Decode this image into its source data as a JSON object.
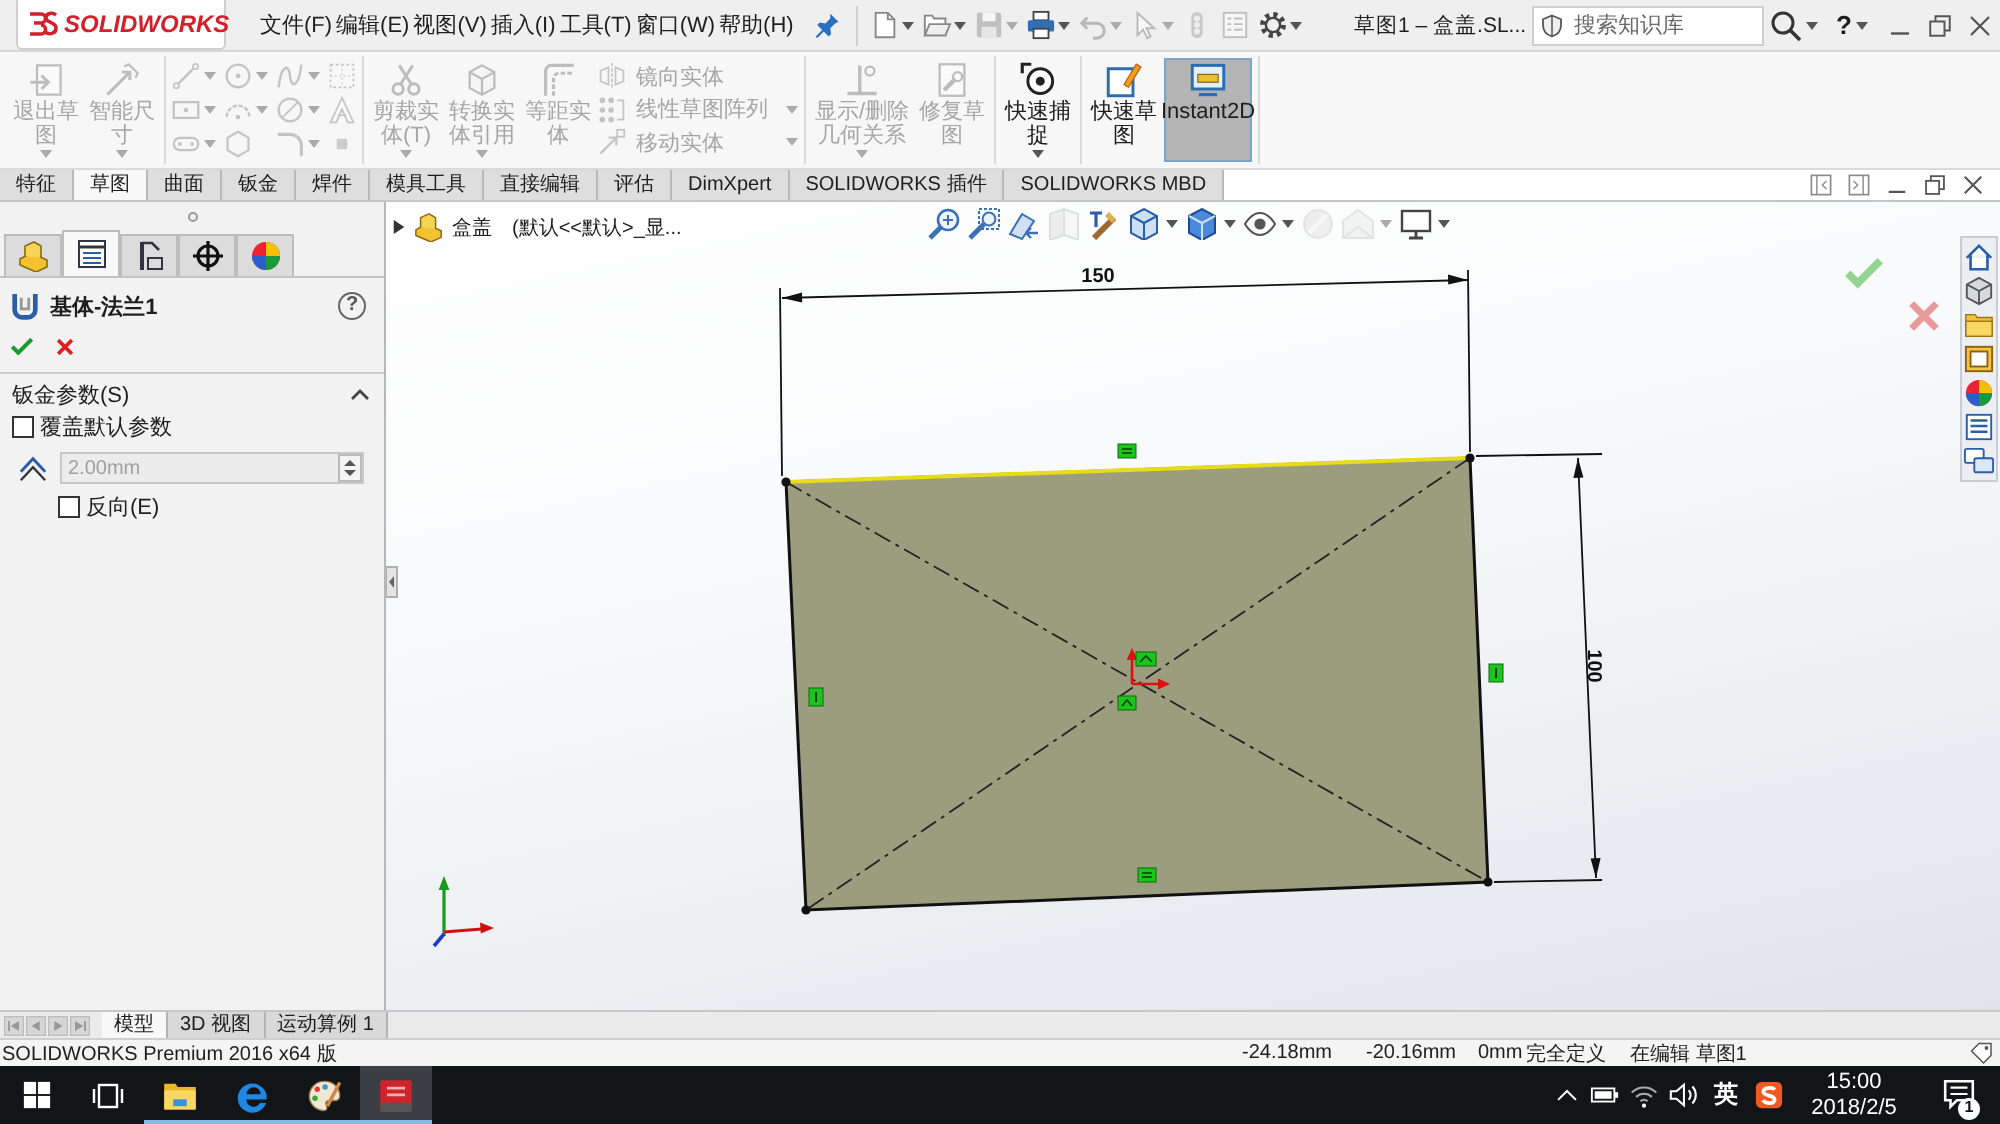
{
  "title_bar": {
    "logo": "SOLIDWORKS",
    "menu": [
      "文件(F)",
      "编辑(E)",
      "视图(V)",
      "插入(I)",
      "工具(T)",
      "窗口(W)",
      "帮助(H)"
    ],
    "quick_access": [
      {
        "kind": "new",
        "disabled": false,
        "dropdown": true
      },
      {
        "kind": "open",
        "disabled": false,
        "dropdown": true
      },
      {
        "kind": "save",
        "disabled": true,
        "dropdown": true
      },
      {
        "kind": "print",
        "disabled": false,
        "dropdown": true
      },
      {
        "kind": "undo",
        "disabled": true,
        "dropdown": true
      },
      {
        "kind": "select",
        "disabled": true,
        "dropdown": true
      },
      {
        "kind": "rebuild",
        "disabled": true,
        "dropdown": false
      },
      {
        "kind": "properties",
        "disabled": true,
        "dropdown": false
      },
      {
        "kind": "options",
        "disabled": false,
        "dropdown": true
      }
    ],
    "document_title": "草图1 – 盒盖.SL...",
    "search": {
      "placeholder": "搜索知识库"
    },
    "help": "?"
  },
  "ribbon": {
    "groups": [
      {
        "buttons": [
          {
            "kind": "exit",
            "label": "退出草图",
            "disabled": true,
            "dropdown": true,
            "on": false
          },
          {
            "kind": "dimension",
            "label": "智能尺寸",
            "disabled": true,
            "dropdown": true,
            "on": false
          }
        ]
      },
      {
        "tools": [
          {
            "kind": "line",
            "disabled": true,
            "dropdown": true
          },
          {
            "kind": "circle",
            "disabled": true,
            "dropdown": true
          },
          {
            "kind": "spline",
            "disabled": true,
            "dropdown": true
          },
          {
            "kind": "grid",
            "disabled": true,
            "dropdown": false
          },
          {
            "kind": "rectangle",
            "disabled": true,
            "dropdown": true
          },
          {
            "kind": "arc",
            "disabled": true,
            "dropdown": true
          },
          {
            "kind": "ellipse",
            "disabled": true,
            "dropdown": true
          },
          {
            "kind": "text",
            "disabled": true,
            "dropdown": false
          },
          {
            "kind": "slot",
            "disabled": true,
            "dropdown": true
          },
          {
            "kind": "polygon",
            "disabled": true,
            "dropdown": false
          },
          {
            "kind": "fillet",
            "disabled": true,
            "dropdown": true
          },
          {
            "kind": "point",
            "disabled": true,
            "dropdown": false
          }
        ]
      },
      {
        "buttons": [
          {
            "kind": "trim",
            "label": "剪裁实体(T)",
            "disabled": true,
            "dropdown": true,
            "on": false
          },
          {
            "kind": "convert",
            "label": "转换实体引用",
            "disabled": true,
            "dropdown": true,
            "on": false
          },
          {
            "kind": "offset",
            "label": "等距实体",
            "disabled": true,
            "dropdown": false,
            "on": false
          }
        ],
        "list": [
          {
            "kind": "mirror",
            "label": "镜向实体",
            "disabled": true,
            "dropdown": false
          },
          {
            "kind": "pattern",
            "label": "线性草图阵列",
            "disabled": true,
            "dropdown": true
          },
          {
            "kind": "move",
            "label": "移动实体",
            "disabled": true,
            "dropdown": true
          }
        ]
      },
      {
        "buttons": [
          {
            "kind": "relations",
            "label": "显示/删除几何关系",
            "disabled": true,
            "dropdown": true,
            "on": false
          },
          {
            "kind": "repair",
            "label": "修复草图",
            "disabled": true,
            "dropdown": false,
            "on": false
          }
        ]
      },
      {
        "buttons": [
          {
            "kind": "snap",
            "label": "快速捕捉",
            "disabled": false,
            "dropdown": true,
            "on": false
          }
        ]
      },
      {
        "buttons": [
          {
            "kind": "rapid",
            "label": "快速草图",
            "disabled": false,
            "dropdown": false,
            "on": false
          },
          {
            "kind": "instant",
            "label": "Instant2D",
            "disabled": false,
            "dropdown": false,
            "on": true
          }
        ]
      }
    ]
  },
  "command_tabs": [
    {
      "label": "特征",
      "selected": false
    },
    {
      "label": "草图",
      "selected": true
    },
    {
      "label": "曲面",
      "selected": false
    },
    {
      "label": "钣金",
      "selected": false
    },
    {
      "label": "焊件",
      "selected": false
    },
    {
      "label": "模具工具",
      "selected": false
    },
    {
      "label": "直接编辑",
      "selected": false
    },
    {
      "label": "评估",
      "selected": false
    },
    {
      "label": "DimXpert",
      "selected": false
    },
    {
      "label": "SOLIDWORKS 插件",
      "selected": false
    },
    {
      "label": "SOLIDWORKS MBD",
      "selected": false
    }
  ],
  "property_manager": {
    "tabs": [
      {
        "kind": "feature",
        "selected": false
      },
      {
        "kind": "property",
        "selected": true
      },
      {
        "kind": "configuration",
        "selected": false
      },
      {
        "kind": "dimxpert",
        "selected": false
      },
      {
        "kind": "display",
        "selected": false
      }
    ],
    "title": "基体-法兰1",
    "help": "?",
    "section": {
      "title": "钣金参数(S)",
      "expanded": true,
      "override": {
        "label": "覆盖默认参数",
        "checked": false
      },
      "thickness": {
        "value": "2.00mm",
        "disabled": true
      },
      "reverse": {
        "label": "反向(E)",
        "checked": false
      }
    }
  },
  "graphics": {
    "tree": {
      "expanded": false,
      "part": "盒盖",
      "configuration": "(默认<<默认>_显..."
    },
    "view_toolbar": [
      {
        "kind": "zoomfit",
        "disabled": false,
        "dropdown": false
      },
      {
        "kind": "zoomarea",
        "disabled": false,
        "dropdown": false
      },
      {
        "kind": "previous",
        "disabled": false,
        "dropdown": false
      },
      {
        "kind": "section",
        "disabled": true,
        "dropdown": false
      },
      {
        "kind": "annotation",
        "disabled": false,
        "dropdown": false
      },
      {
        "kind": "orientation",
        "disabled": false,
        "dropdown": true
      },
      {
        "kind": "style",
        "disabled": false,
        "dropdown": true
      },
      {
        "kind": "visibility",
        "disabled": false,
        "dropdown": true
      },
      {
        "kind": "appearance",
        "disabled": true,
        "dropdown": false
      },
      {
        "kind": "scene",
        "disabled": true,
        "dropdown": true
      },
      {
        "kind": "settings",
        "disabled": false,
        "dropdown": true
      }
    ],
    "sketch": {
      "width_dimension": "150",
      "height_dimension": "100"
    }
  },
  "bottom_tabs": [
    {
      "label": "模型",
      "selected": true
    },
    {
      "label": "3D 视图",
      "selected": false
    },
    {
      "label": "运动算例 1",
      "selected": false
    }
  ],
  "status_bar": {
    "product": "SOLIDWORKS Premium 2016 x64 版",
    "x": "-24.18mm",
    "y": "-20.16mm",
    "z": "0mm",
    "state": "完全定义",
    "editing": "在编辑 草图1"
  },
  "taskbar": {
    "apps": [
      {
        "kind": "explorer",
        "running": true,
        "selected": false
      },
      {
        "kind": "edge",
        "running": true,
        "selected": false
      },
      {
        "kind": "paint",
        "running": true,
        "selected": false
      },
      {
        "kind": "solidworks",
        "running": true,
        "selected": true
      }
    ],
    "input_language": "英",
    "time": "15:00",
    "date": "2018/2/5",
    "notifications": "1"
  }
}
